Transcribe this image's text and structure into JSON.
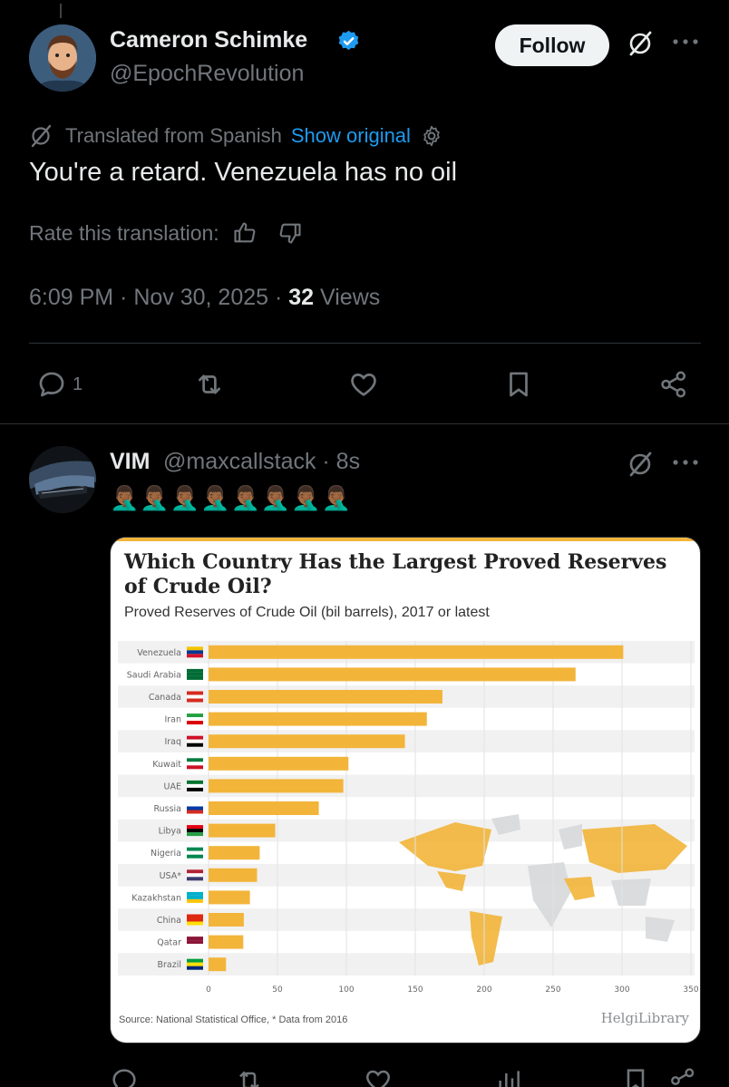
{
  "tweet1": {
    "display_name": "Cameron Schimke",
    "handle": "@EpochRevolution",
    "follow_label": "Follow",
    "translation_label": "Translated from Spanish",
    "show_original_label": "Show original",
    "text": "You're a retard. Venezuela has no oil",
    "rate_label": "Rate this translation:",
    "time": "6:09 PM · Nov 30, 2025 · ",
    "views_count": "32",
    "views_label": " Views",
    "reply_count": "1"
  },
  "tweet2": {
    "display_name": "VIM",
    "handle": "@maxcallstack · 8s",
    "emojis": "🤦🏾‍♂️🤦🏾‍♂️🤦🏾‍♂️🤦🏾‍♂️🤦🏾‍♂️🤦🏾‍♂️🤦🏾‍♂️🤦🏾‍♂️"
  },
  "colors": {
    "accent": "#1d9bf0",
    "bar": "#f2b53a",
    "muted": "#71767b"
  },
  "chart_data": {
    "type": "bar",
    "orientation": "horizontal",
    "title": "Which Country Has the Largest Proved Reserves of Crude Oil?",
    "subtitle": "Proved Reserves of Crude Oil (bil barrels), 2017 or latest",
    "categories": [
      "Venezuela",
      "Saudi Arabia",
      "Canada",
      "Iran",
      "Iraq",
      "Kuwait",
      "UAE",
      "Russia",
      "Libya",
      "Nigeria",
      "USA*",
      "Kazakhstan",
      "China",
      "Qatar",
      "Brazil"
    ],
    "values": [
      300.9,
      266.3,
      169.7,
      158.4,
      142.5,
      101.5,
      97.8,
      80.0,
      48.4,
      37.1,
      35.2,
      30.0,
      25.6,
      25.2,
      12.7
    ],
    "xticks": [
      0,
      50,
      100,
      150,
      200,
      250,
      300,
      350
    ],
    "xlim": [
      0,
      350
    ],
    "source": "Source: National Statistical Office, * Data from 2016",
    "brand": "HelgiLibrary"
  }
}
